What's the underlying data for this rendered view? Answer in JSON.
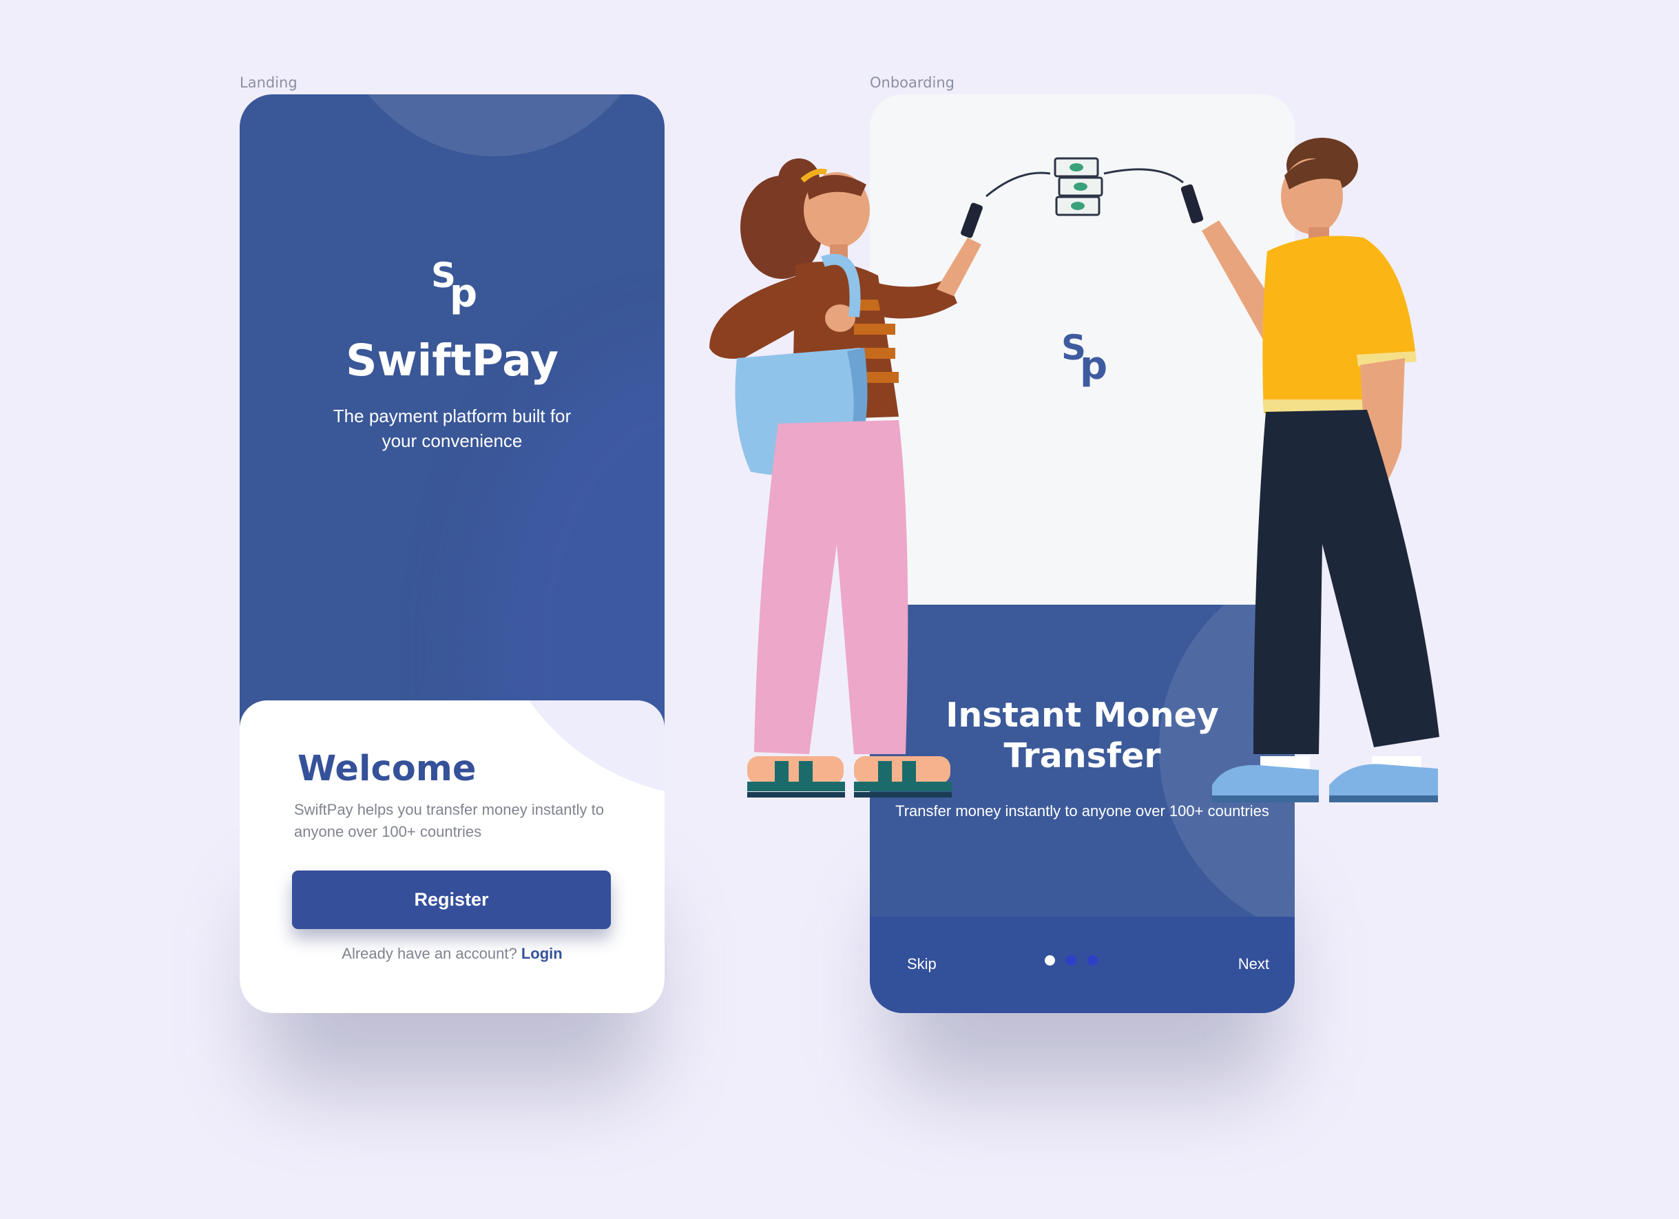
{
  "frames": {
    "landing_label": "Landing",
    "onboarding_label": "Onboarding"
  },
  "landing": {
    "logo_text": "Sp",
    "logo_s": "S",
    "logo_p": "p",
    "app_name": "SwiftPay",
    "tagline": "The payment platform built for your convenience",
    "welcome_title": "Welcome",
    "welcome_description": "SwiftPay helps you transfer money instantly to anyone over 100+ countries",
    "register_label": "Register",
    "login_prompt": "Already have an account?",
    "login_label": "Login"
  },
  "onboarding": {
    "logo_s": "S",
    "logo_p": "p",
    "title": "Instant Money Transfer",
    "description": "Transfer money instantly to anyone over 100+ countries",
    "skip_label": "Skip",
    "next_label": "Next",
    "pagination": {
      "total": 3,
      "active_index": 0
    }
  },
  "colors": {
    "brand_blue": "#3a5797",
    "button_blue": "#354f9b",
    "background": "#f0eefb",
    "dot_inactive": "#2e3fc7"
  },
  "icons": [
    "swiftpay-logo-icon",
    "money-stack-icon",
    "phone-icon"
  ]
}
